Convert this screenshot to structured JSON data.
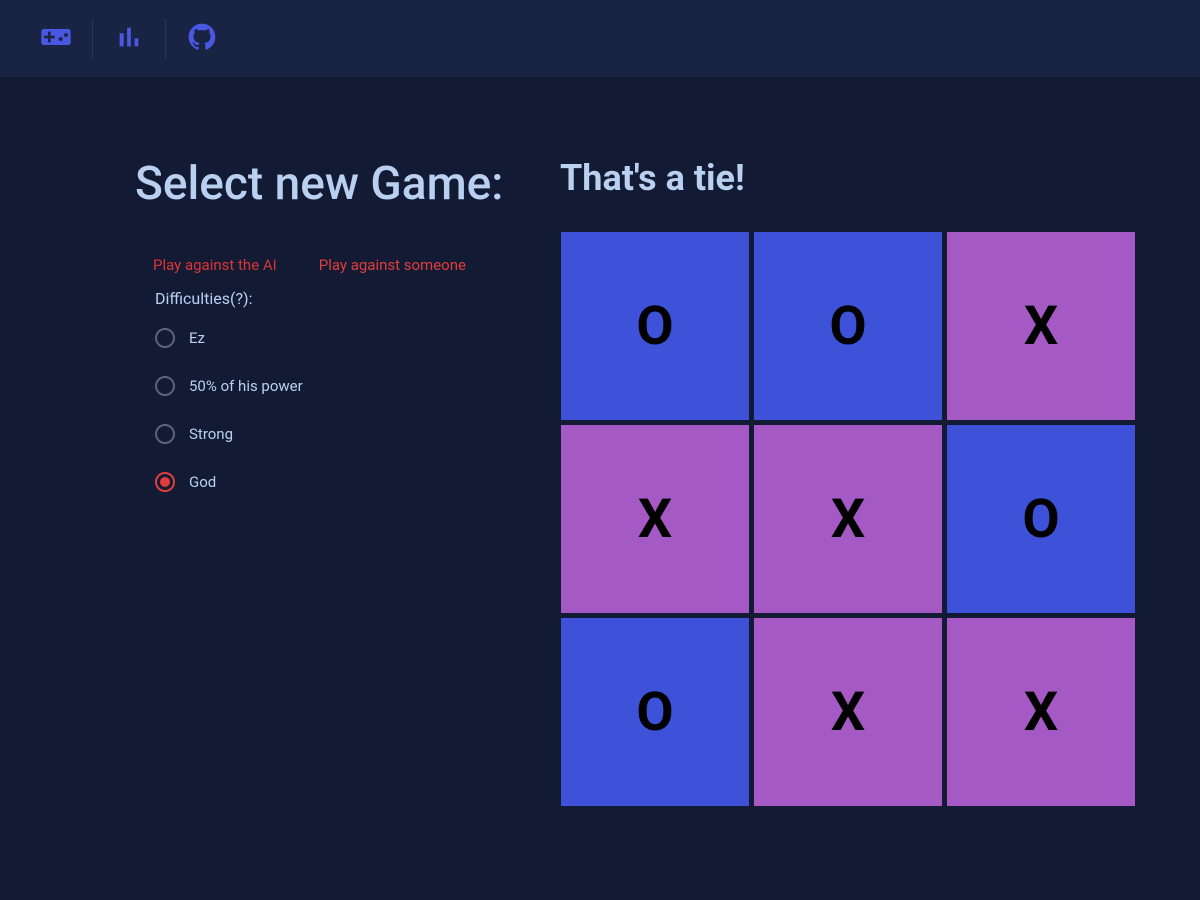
{
  "header": {
    "nav_items": [
      "games",
      "stats",
      "github"
    ]
  },
  "page_title": "Select new Game:",
  "modes": {
    "ai_label": "Play against the AI",
    "someone_label": "Play against someone"
  },
  "difficulties": {
    "label": "Difficulties(?):",
    "options": [
      {
        "label": "Ez",
        "selected": false
      },
      {
        "label": "50% of his power",
        "selected": false
      },
      {
        "label": "Strong",
        "selected": false
      },
      {
        "label": "God",
        "selected": true
      }
    ]
  },
  "game": {
    "status": "That's a tie!",
    "board": [
      {
        "mark": "O",
        "type": "o"
      },
      {
        "mark": "O",
        "type": "o"
      },
      {
        "mark": "X",
        "type": "x"
      },
      {
        "mark": "X",
        "type": "x"
      },
      {
        "mark": "X",
        "type": "x"
      },
      {
        "mark": "O",
        "type": "o"
      },
      {
        "mark": "O",
        "type": "o"
      },
      {
        "mark": "X",
        "type": "x"
      },
      {
        "mark": "X",
        "type": "x"
      }
    ]
  }
}
